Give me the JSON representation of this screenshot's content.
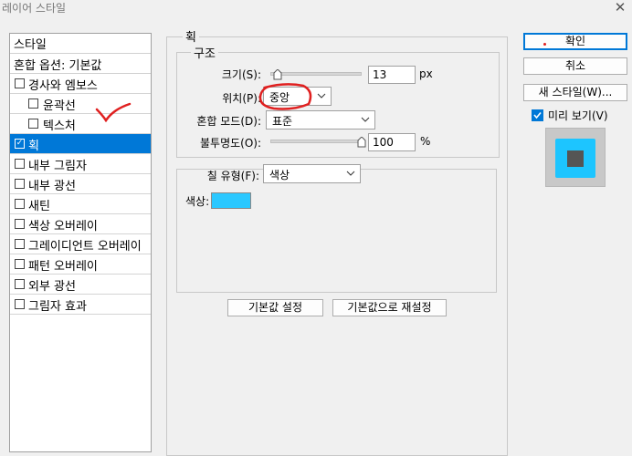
{
  "window": {
    "title": "레이어 스타일"
  },
  "stylelist": {
    "header": "스타일",
    "blend_options": "혼합 옵션: 기본값",
    "items": [
      {
        "label": "경사와 엠보스",
        "checked": false,
        "indent": false
      },
      {
        "label": "윤곽선",
        "checked": false,
        "indent": true
      },
      {
        "label": "텍스처",
        "checked": false,
        "indent": true
      },
      {
        "label": "획",
        "checked": true,
        "selected": true,
        "indent": false
      },
      {
        "label": "내부 그림자",
        "checked": false,
        "indent": false
      },
      {
        "label": "내부 광선",
        "checked": false,
        "indent": false
      },
      {
        "label": "새틴",
        "checked": false,
        "indent": false
      },
      {
        "label": "색상 오버레이",
        "checked": false,
        "indent": false
      },
      {
        "label": "그레이디언트 오버레이",
        "checked": false,
        "indent": false
      },
      {
        "label": "패턴 오버레이",
        "checked": false,
        "indent": false
      },
      {
        "label": "외부 광선",
        "checked": false,
        "indent": false
      },
      {
        "label": "그림자 효과",
        "checked": false,
        "indent": false
      }
    ]
  },
  "stroke": {
    "section_title": "획",
    "structure_title": "구조",
    "size": {
      "label": "크기(S):",
      "value": "13",
      "unit": "px",
      "slider_fraction": 0.05
    },
    "position": {
      "label": "위치(P):",
      "value": "중앙"
    },
    "blend_mode": {
      "label": "혼합 모드(D):",
      "value": "표준"
    },
    "opacity": {
      "label": "불투명도(O):",
      "value": "100",
      "unit": "%",
      "slider_fraction": 1.0
    },
    "fill_type": {
      "label": "칠 유형(F):",
      "value": "색상"
    },
    "color": {
      "label": "색상:",
      "hex": "#2bc8ff"
    },
    "btn_default_set": "기본값 설정",
    "btn_default_reset": "기본값으로 재설정"
  },
  "actions": {
    "ok": "확인",
    "cancel": "취소",
    "new_style": "새 스타일(W)...",
    "preview_label": "미리 보기(V)",
    "preview_checked": true
  },
  "colors": {
    "accent": "#0078d7",
    "annotation_red": "#e02020",
    "preview_stroke": "#1dc5ff"
  }
}
